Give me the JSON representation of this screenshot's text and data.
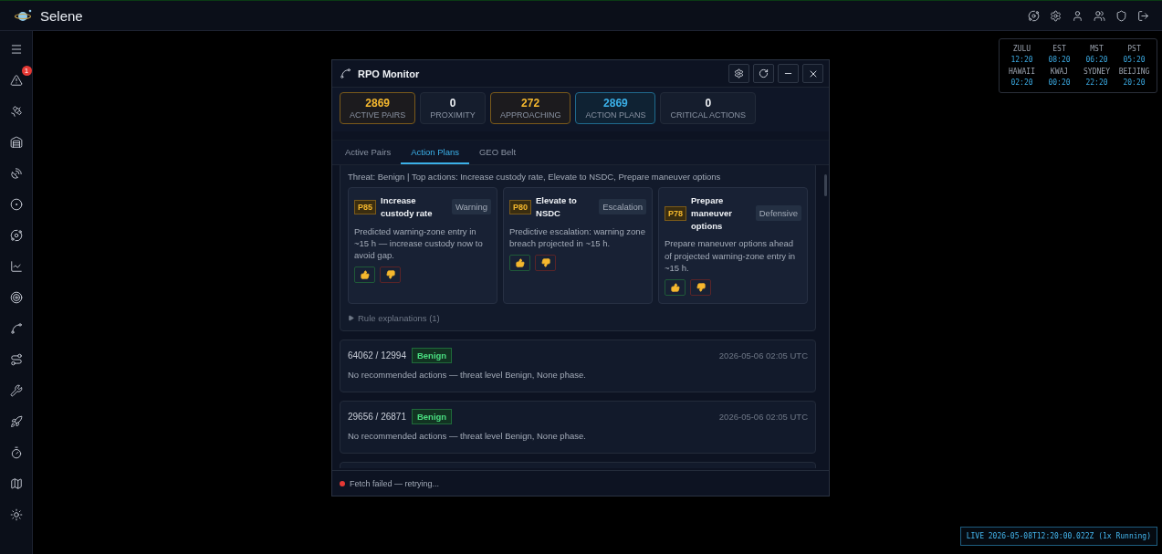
{
  "app": {
    "title": "Selene"
  },
  "sidebar": {
    "alert_badge": "1"
  },
  "clocks": [
    {
      "zone": "ZULU",
      "time": "12:20"
    },
    {
      "zone": "EST",
      "time": "08:20"
    },
    {
      "zone": "MST",
      "time": "06:20"
    },
    {
      "zone": "PST",
      "time": "05:20"
    },
    {
      "zone": "HAWAII",
      "time": "02:20"
    },
    {
      "zone": "KWAJ",
      "time": "00:20"
    },
    {
      "zone": "SYDNEY",
      "time": "22:20"
    },
    {
      "zone": "BEIJING",
      "time": "20:20"
    }
  ],
  "window": {
    "title": "RPO Monitor",
    "stats": [
      {
        "value": "2869",
        "label": "ACTIVE PAIRS",
        "kind": "warning"
      },
      {
        "value": "0",
        "label": "PROXIMITY",
        "kind": "neutral"
      },
      {
        "value": "272",
        "label": "APPROACHING",
        "kind": "warning"
      },
      {
        "value": "2869",
        "label": "ACTION PLANS",
        "kind": "info"
      },
      {
        "value": "0",
        "label": "CRITICAL ACTIONS",
        "kind": "neutral"
      }
    ],
    "tabs": [
      {
        "label": "Active Pairs",
        "selected": false
      },
      {
        "label": "Action Plans",
        "selected": true
      },
      {
        "label": "GEO Belt",
        "selected": false
      }
    ],
    "plan": {
      "summary": "Threat: Benign | Top actions: Increase custody rate, Elevate to NSDC, Prepare maneuver options",
      "actions": [
        {
          "priority": "P85",
          "title": "Increase custody rate",
          "tag": "Warning",
          "text": "Predicted warning-zone entry in ~15 h — increase custody now to avoid gap."
        },
        {
          "priority": "P80",
          "title": "Elevate to NSDC",
          "tag": "Escalation",
          "text": "Predictive escalation: warning zone breach projected in ~15 h."
        },
        {
          "priority": "P78",
          "title": "Prepare maneuver options",
          "tag": "Defensive",
          "text": "Prepare maneuver options ahead of projected warning-zone entry in ~15 h."
        }
      ],
      "rules": "Rule explanations (1)",
      "expanded": false
    },
    "pairs": [
      {
        "id": "64062 / 12994",
        "threat": "Benign",
        "time": "2026-05-06 02:05 UTC",
        "text": "No recommended actions — threat level Benign, None phase."
      },
      {
        "id": "29656 / 26871",
        "threat": "Benign",
        "time": "2026-05-06 02:05 UTC",
        "text": "No recommended actions — threat level Benign, None phase."
      }
    ],
    "status": {
      "text": "Fetch failed — retrying...",
      "color": "#e53935"
    }
  },
  "live": "LIVE 2026-05-08T12:20:00.022Z (1x Running)"
}
